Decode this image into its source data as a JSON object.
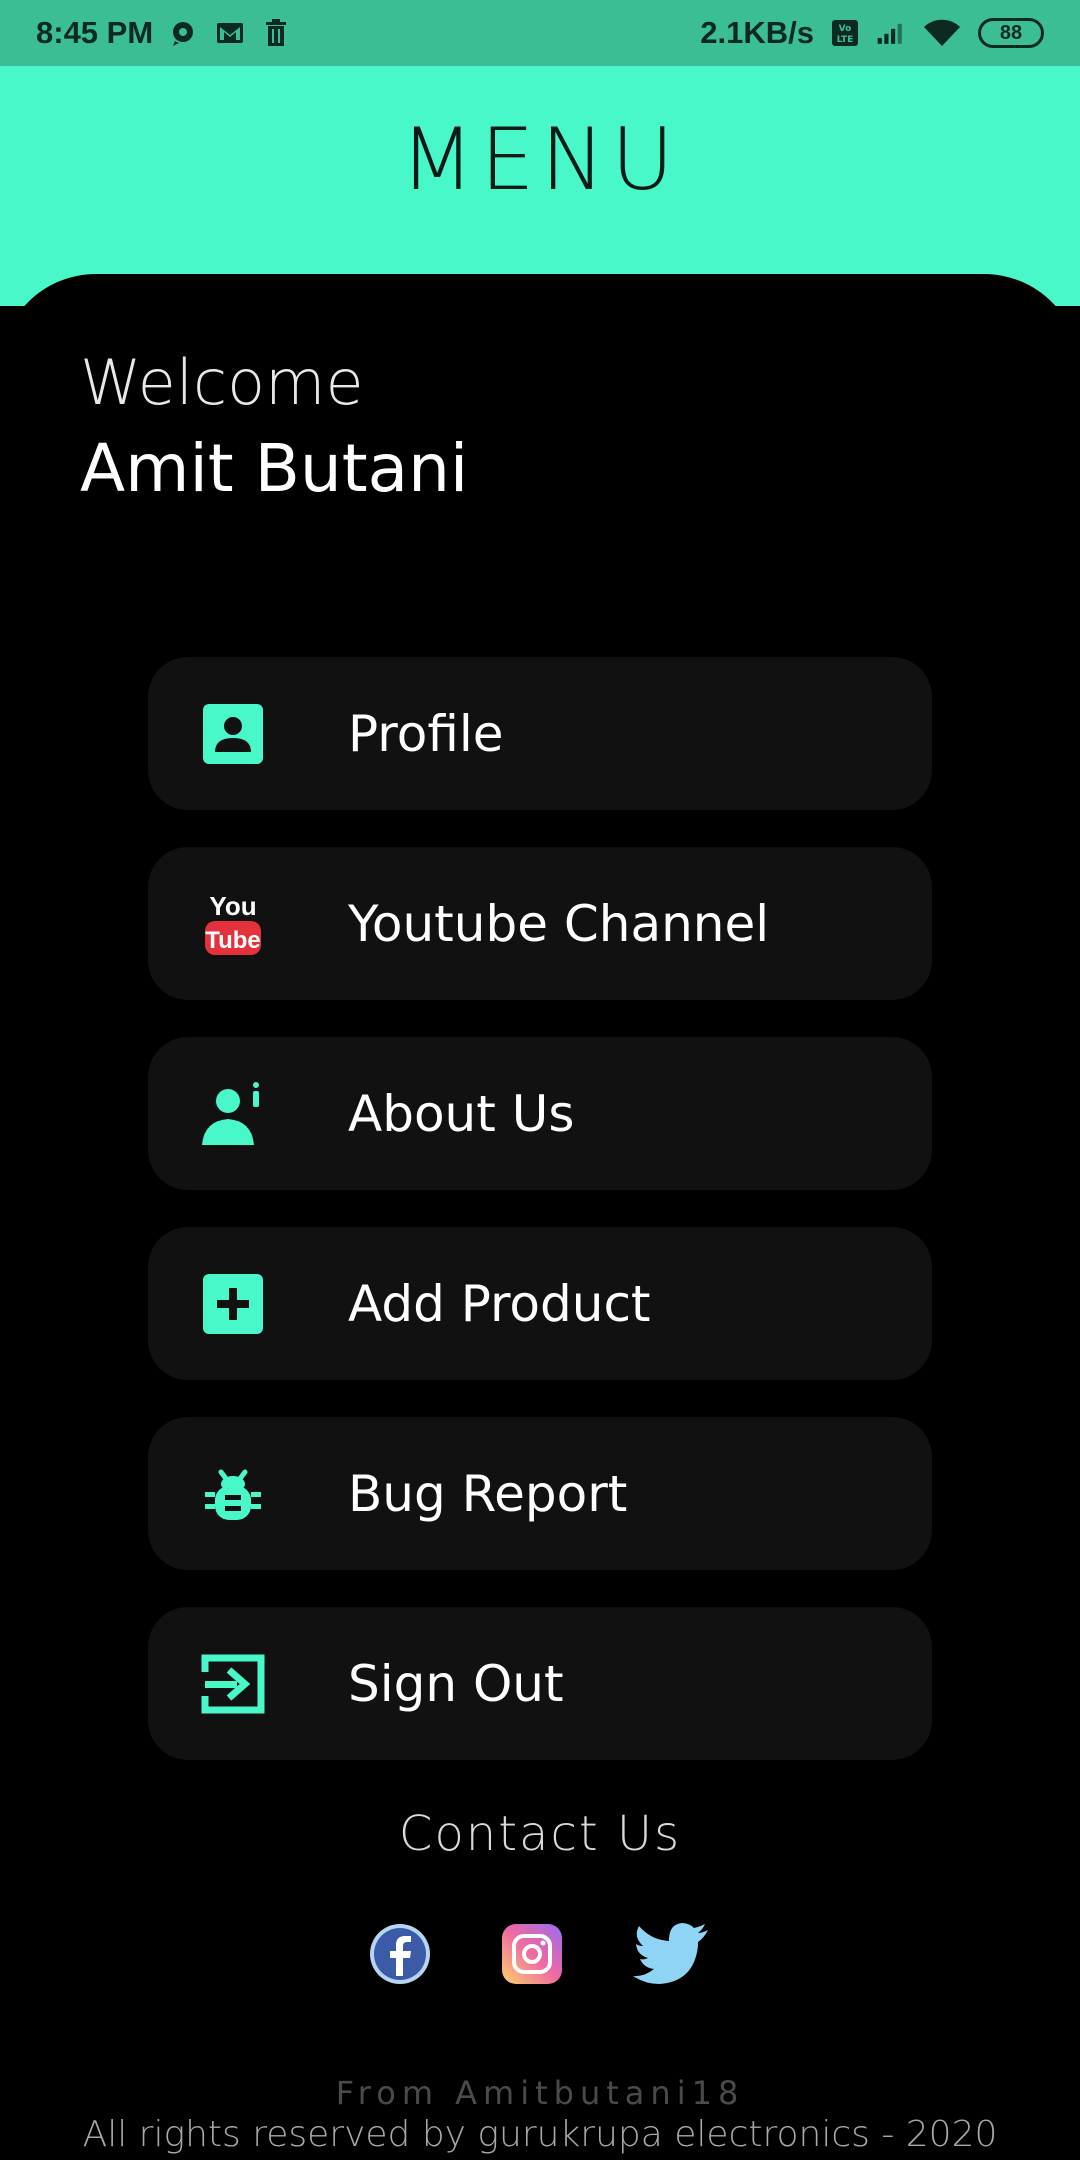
{
  "status_bar": {
    "time": "8:45 PM",
    "speed": "2.1KB/s",
    "battery": "88",
    "icons": [
      "chat-icon",
      "gmail-icon",
      "trash-icon",
      "volte-icon",
      "signal-icon",
      "wifi-icon",
      "battery-icon"
    ]
  },
  "header": {
    "title": "MENU"
  },
  "user": {
    "greeting": "Welcome",
    "name": "Amit Butani"
  },
  "menu": {
    "items": [
      {
        "label": "Profile",
        "icon": "profile-icon"
      },
      {
        "label": "Youtube Channel",
        "icon": "youtube-icon"
      },
      {
        "label": "About Us",
        "icon": "about-icon"
      },
      {
        "label": "Add Product",
        "icon": "add-icon"
      },
      {
        "label": "Bug Report",
        "icon": "bug-icon"
      },
      {
        "label": "Sign Out",
        "icon": "sign-out-icon"
      }
    ]
  },
  "contact": {
    "title": "Contact Us",
    "socials": [
      "facebook-icon",
      "instagram-icon",
      "twitter-icon"
    ]
  },
  "footer": {
    "from": "From Amitbutani18",
    "rights": "All rights reserved by gurukrupa electronics - 2020"
  },
  "colors": {
    "accent": "#48f8c8",
    "status_bar": "#3bbd95",
    "card": "#111111",
    "background": "#000000"
  }
}
